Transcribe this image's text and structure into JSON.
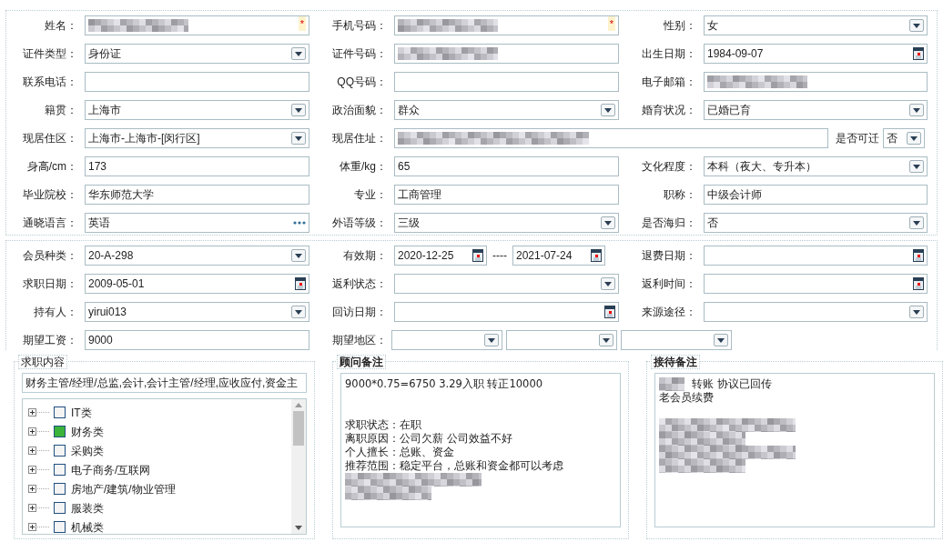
{
  "basic_rows": [
    [
      {
        "label": "姓名：",
        "kind": "text",
        "redacted": true,
        "marker": "*"
      },
      {
        "label": "手机号码：",
        "kind": "text",
        "redacted": true,
        "marker": "*"
      },
      {
        "label": "性别：",
        "kind": "select",
        "value": "女"
      }
    ],
    [
      {
        "label": "证件类型：",
        "kind": "select",
        "value": "身份证"
      },
      {
        "label": "证件号码：",
        "kind": "text",
        "redacted": true
      },
      {
        "label": "出生日期：",
        "kind": "date",
        "value": "1984-09-07"
      }
    ],
    [
      {
        "label": "联系电话：",
        "kind": "text"
      },
      {
        "label": "QQ号码：",
        "kind": "text"
      },
      {
        "label": "电子邮箱：",
        "kind": "text",
        "redacted": true
      }
    ],
    [
      {
        "label": "籍贯：",
        "kind": "select",
        "value": "上海市"
      },
      {
        "label": "政治面貌：",
        "kind": "select",
        "value": "群众"
      },
      {
        "label": "婚育状况：",
        "kind": "select",
        "value": "已婚已育"
      }
    ],
    [
      {
        "label": "现居住区：",
        "kind": "select",
        "value": " 上海市-上海市-[闵行区]"
      },
      {
        "label": "现居住址：",
        "kind": "text",
        "redacted": true,
        "wide": true,
        "extra": {
          "label": "是否可迁",
          "value": "否"
        }
      }
    ],
    [
      {
        "label": "身高/cm：",
        "kind": "text",
        "value": "173"
      },
      {
        "label": "体重/kg：",
        "kind": "text",
        "value": "65"
      },
      {
        "label": "文化程度：",
        "kind": "select",
        "value": "本科（夜大、专升本）"
      }
    ],
    [
      {
        "label": "毕业院校：",
        "kind": "text",
        "value": "华东师范大学"
      },
      {
        "label": "专业：",
        "kind": "text",
        "value": "工商管理"
      },
      {
        "label": "职称：",
        "kind": "text",
        "value": "中级会计师"
      }
    ],
    [
      {
        "label": "通晓语言：",
        "kind": "lookup",
        "value": "英语"
      },
      {
        "label": "外语等级：",
        "kind": "select",
        "value": "三级"
      },
      {
        "label": "是否海归：",
        "kind": "select",
        "value": "否"
      }
    ]
  ],
  "member_rows": [
    [
      {
        "label": "会员种类：",
        "kind": "select",
        "value": " 20-A-298"
      },
      {
        "label": "有效期：",
        "kind": "daterange",
        "values": [
          "2020-12-25",
          "2021-07-24"
        ],
        "separator": "----"
      },
      {
        "label": "退费日期：",
        "kind": "date"
      }
    ],
    [
      {
        "label": "求职日期：",
        "kind": "date",
        "value": "2009-05-01"
      },
      {
        "label": "返利状态：",
        "kind": "select"
      },
      {
        "label": "返利时间：",
        "kind": "date"
      }
    ],
    [
      {
        "label": "持有人：",
        "kind": "select",
        "value": "yirui013"
      },
      {
        "label": "回访日期：",
        "kind": "date"
      },
      {
        "label": "来源途径：",
        "kind": "select"
      }
    ],
    [
      {
        "label": "期望工资：",
        "kind": "text",
        "value": "9000"
      },
      {
        "label": "期望地区：",
        "kind": "multiselect",
        "parts": [
          {
            "kind": "select"
          },
          {
            "kind": "select"
          },
          {
            "kind": "select"
          }
        ]
      }
    ]
  ],
  "job_content": {
    "legend": "求职内容",
    "value": "财务主管/经理/总监,会计,会计主管/经理,应收应付,资金主",
    "tree": [
      {
        "label": "IT类",
        "checked": false,
        "expanded": false
      },
      {
        "label": "财务类",
        "checked": true,
        "expanded": false
      },
      {
        "label": "采购类",
        "checked": false,
        "expanded": false
      },
      {
        "label": "电子商务/互联网",
        "checked": false,
        "expanded": false
      },
      {
        "label": "房地产/建筑/物业管理",
        "checked": false,
        "expanded": false
      },
      {
        "label": "服装类",
        "checked": false,
        "expanded": false
      },
      {
        "label": "机械类",
        "checked": false,
        "expanded": false
      }
    ]
  },
  "notes": [
    {
      "legend": "顾问备注",
      "lines": [
        {
          "kind": "text",
          "text": "9000*0.75=6750  3.29入职  转正10000"
        },
        {
          "kind": "blank"
        },
        {
          "kind": "blank"
        },
        {
          "kind": "text",
          "text": "求职状态：在职"
        },
        {
          "kind": "text",
          "text": "离职原因：公司欠薪 公司效益不好"
        },
        {
          "kind": "text",
          "text": "个人擅长：总账、资金"
        },
        {
          "kind": "text",
          "text": "推荐范围：稳定平台，总账和资金都可以考虑"
        },
        {
          "kind": "redacted"
        },
        {
          "kind": "redacted"
        }
      ]
    },
    {
      "legend": "接待备注",
      "lines": [
        {
          "kind": "text",
          "text": "转账 协议已回传",
          "redacted_prefix": true
        },
        {
          "kind": "text",
          "text": "老会员续费"
        },
        {
          "kind": "blank"
        },
        {
          "kind": "redacted"
        },
        {
          "kind": "redacted"
        },
        {
          "kind": "redacted"
        },
        {
          "kind": "redacted"
        }
      ]
    }
  ]
}
